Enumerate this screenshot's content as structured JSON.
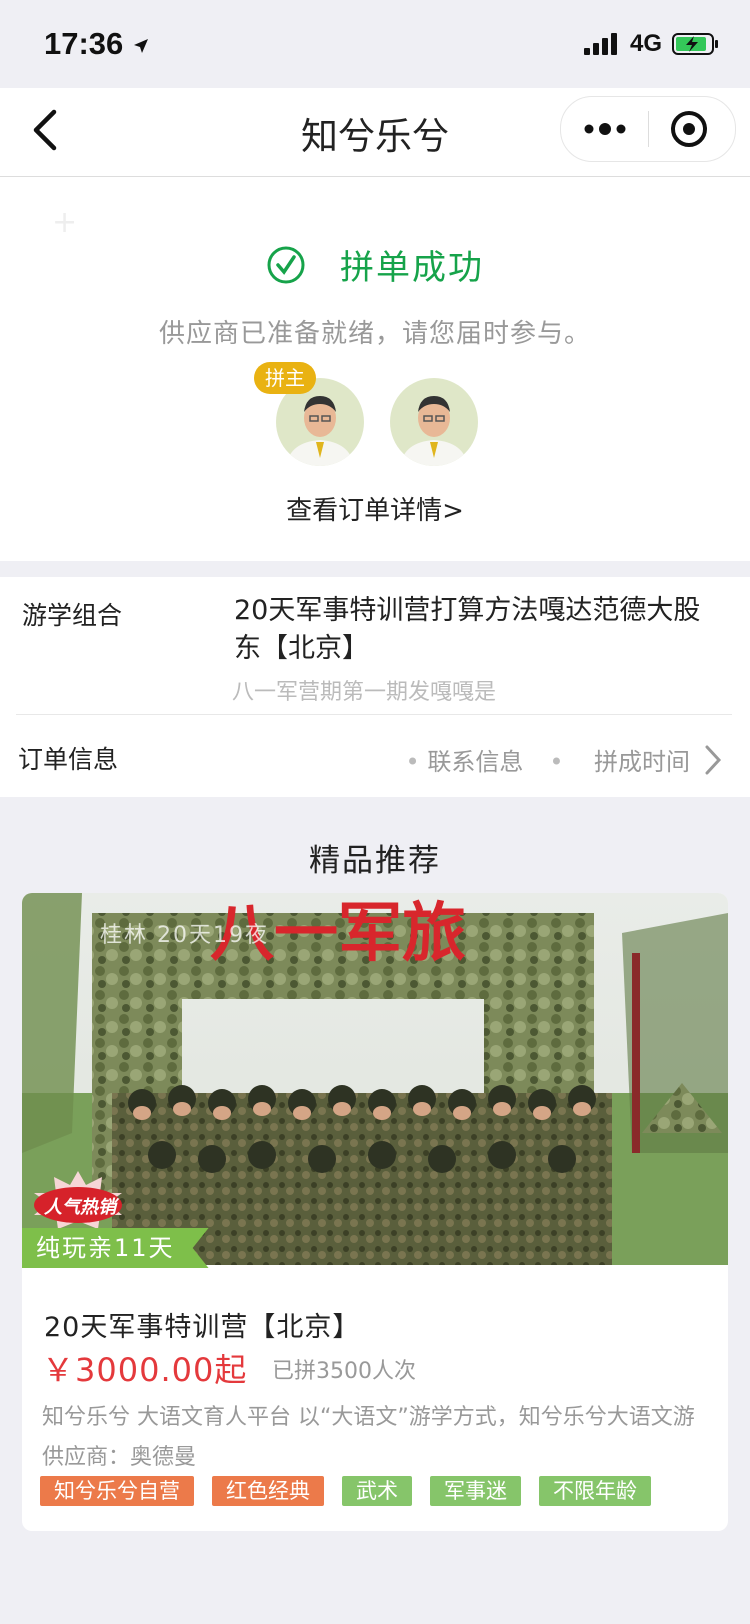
{
  "status_bar": {
    "time": "17:36",
    "network": "4G"
  },
  "nav": {
    "title": "知兮乐兮"
  },
  "success": {
    "title": "拼单成功",
    "subtitle": "供应商已准备就绪，请您届时参与。",
    "host_badge": "拼主",
    "order_link": "查看订单详情>"
  },
  "study_group": {
    "label": "游学组合",
    "title": "20天军事特训营打算方法嘎达范德大股东【北京】",
    "subtitle": "八一军营期第一期发嘎嘎是"
  },
  "order_info": {
    "label": "订单信息",
    "contact": "联系信息",
    "time": "拼成时间"
  },
  "recommend": {
    "title": "精品推荐",
    "card": {
      "photo_caption": "桂林 20天19夜",
      "sign_text": "八一军旅",
      "hot_badge": "人气热销",
      "tagline": "纯玩亲11天",
      "title": "20天军事特训营【北京】",
      "price": "￥3000.00起",
      "sold": "已拼3500人次",
      "description": "知兮乐兮 大语文育人平台 以“大语文”游学方式，知兮乐兮大语文游",
      "supplier": "供应商：奥德曼",
      "tags": [
        "知兮乐兮自营",
        "红色经典",
        "武术",
        "军事迷",
        "不限年龄"
      ]
    }
  },
  "colors": {
    "success_green": "#16a34a",
    "price_red": "#e4393c",
    "tag_orange": "#ec7a4a",
    "tag_green": "#86c56a",
    "badge_yellow": "#e9b212"
  }
}
